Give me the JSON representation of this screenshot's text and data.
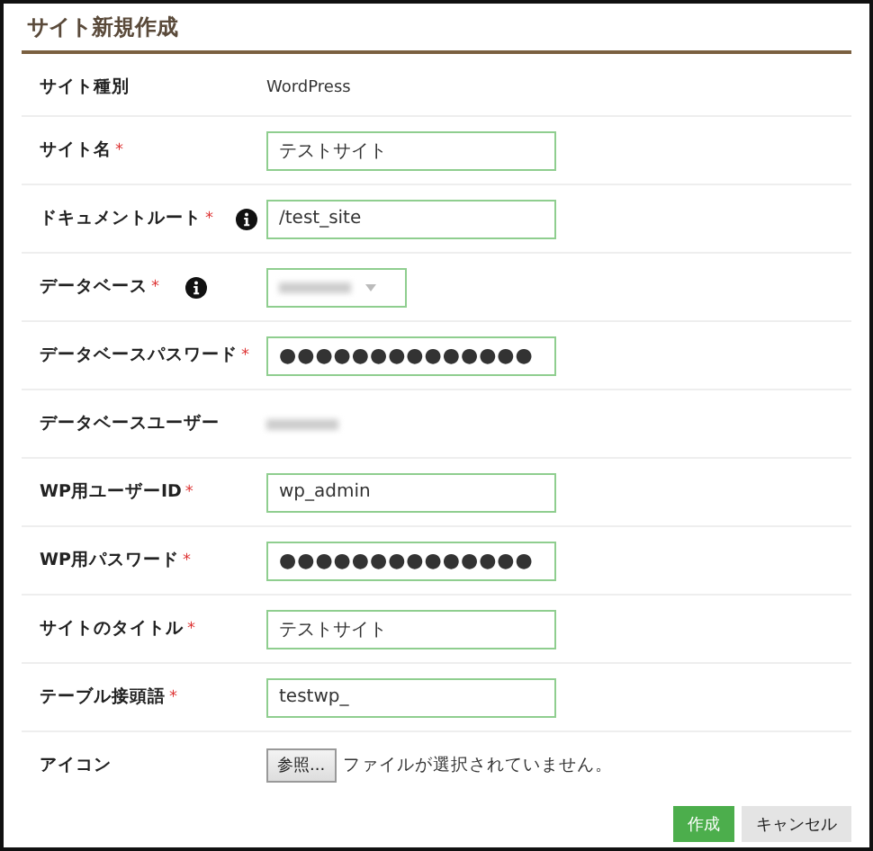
{
  "title": "サイト新規作成",
  "fields": [
    {
      "kind": "static",
      "label": "サイト種別",
      "required": false,
      "info": false,
      "value": "WordPress",
      "redacted": false
    },
    {
      "kind": "text",
      "label": "サイト名",
      "required": true,
      "info": false,
      "value": "テストサイト"
    },
    {
      "kind": "text",
      "label": "ドキュメントルート",
      "required": true,
      "info": true,
      "value": "/test_site"
    },
    {
      "kind": "select",
      "label": "データベース",
      "required": true,
      "info": true,
      "redacted": true
    },
    {
      "kind": "password",
      "label": "データベースパスワード",
      "required": true,
      "info": false,
      "value": "●●●●●●●●●●●●●●"
    },
    {
      "kind": "static",
      "label": "データベースユーザー",
      "required": false,
      "info": false,
      "redacted": true
    },
    {
      "kind": "text",
      "label": "WP用ユーザーID",
      "required": true,
      "info": false,
      "value": "wp_admin"
    },
    {
      "kind": "password",
      "label": "WP用パスワード",
      "required": true,
      "info": false,
      "value": "●●●●●●●●●●●●●●"
    },
    {
      "kind": "text",
      "label": "サイトのタイトル",
      "required": true,
      "info": false,
      "value": "テストサイト"
    },
    {
      "kind": "text",
      "label": "テーブル接頭語",
      "required": true,
      "info": false,
      "value": "testwp_"
    },
    {
      "kind": "file",
      "label": "アイコン",
      "required": false,
      "info": false,
      "button": "参照...",
      "status": "ファイルが選択されていません。"
    }
  ],
  "required_mark": "*",
  "buttons": [
    {
      "kind": "primary",
      "label": "作成"
    },
    {
      "kind": "secondary",
      "label": "キャンセル"
    }
  ]
}
